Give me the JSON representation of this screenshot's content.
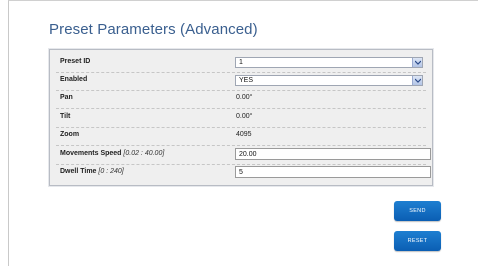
{
  "page": {
    "title": "Preset Parameters (Advanced)"
  },
  "fields": {
    "preset_id": {
      "label": "Preset ID",
      "value": "1"
    },
    "enabled": {
      "label": "Enabled",
      "value": "YES"
    },
    "pan": {
      "label": "Pan",
      "value": "0.00°"
    },
    "tilt": {
      "label": "Tilt",
      "value": "0.00°"
    },
    "zoom": {
      "label": "Zoom",
      "value": "4095"
    },
    "movements_speed": {
      "label": "Movements Speed",
      "range": "[0.02 : 40.00]",
      "value": "20.00"
    },
    "dwell_time": {
      "label": "Dwell Time",
      "range": "[0 : 240]",
      "value": "5"
    }
  },
  "buttons": {
    "send": "SEND",
    "reset": "RESET"
  },
  "icons": {
    "dropdown": "chevron-down-icon"
  },
  "colors": {
    "title": "#3a5f8f",
    "button": "#0f67be",
    "panel_bg": "#efefef"
  }
}
